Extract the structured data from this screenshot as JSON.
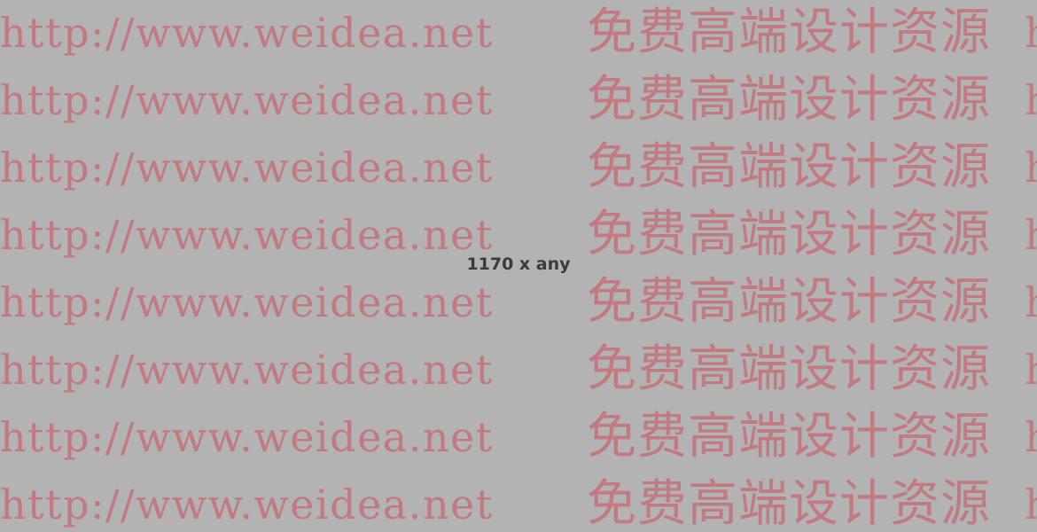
{
  "placeholder": {
    "size_label": "1170 x any",
    "background_color": "#b3b3b3",
    "watermark_color": "#c07a80",
    "watermark": {
      "url_text": "http://www.weidea.net",
      "cn_text": "免费高端设计资源",
      "tail_text": "h"
    }
  }
}
